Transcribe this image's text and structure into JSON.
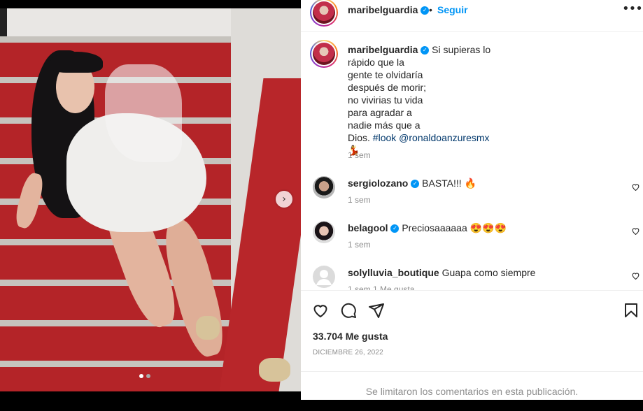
{
  "post": {
    "author": "maribelguardia",
    "follow_label": "Seguir",
    "separator": "•",
    "more_label": "•••"
  },
  "caption": {
    "username": "maribelguardia",
    "line1": " Si supieras lo",
    "line2": "rápido que la",
    "line3": "gente te olvidaría",
    "line4": "después de morir;",
    "line5": "no vivirias tu vida",
    "line6": "para agradar a",
    "line7": "nadie más que a",
    "line8": "Dios. ",
    "hashtag": "#look",
    "mention": "@ronaldoanzuresmx",
    "emoji": "💃",
    "time": "1 sem"
  },
  "comments": [
    {
      "username": "sergiolozano",
      "text": "BASTA!!! 🔥",
      "time": "1 sem"
    },
    {
      "username": "belagool",
      "text": "Preciosaaaaaa 😍😍😍",
      "time": "1 sem"
    },
    {
      "username": "solylluvia_boutique",
      "text": "Guapa como siempre",
      "time": "1 sem   1 Me gusta"
    }
  ],
  "stats": {
    "likes": "33.704 Me gusta",
    "date": "DICIEMBRE 26, 2022"
  },
  "footer": {
    "limited": "Se limitaron los comentarios en esta publicación."
  },
  "carousel": {
    "next_label": "›"
  },
  "icons": {
    "verified": "verified-badge-icon",
    "like": "heart-icon",
    "comment": "comment-icon",
    "share": "paper-plane-icon",
    "save": "bookmark-icon"
  },
  "colors": {
    "accent": "#0095f6",
    "text": "#262626",
    "muted": "#8e8e8e"
  }
}
